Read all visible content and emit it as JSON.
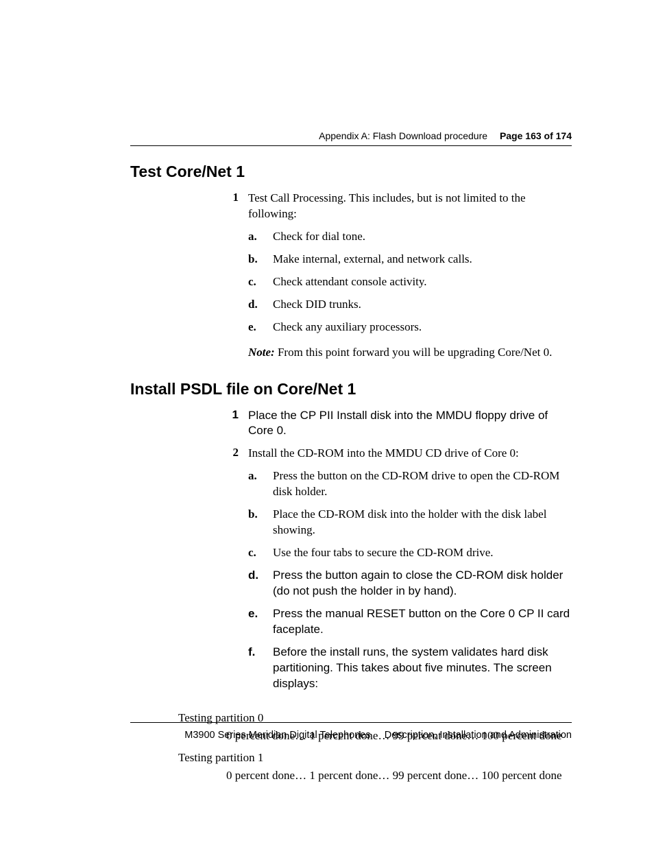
{
  "header": {
    "appendix": "Appendix A: Flash Download procedure",
    "page": "Page 163 of 174"
  },
  "section1": {
    "heading": "Test Core/Net 1",
    "steps": [
      {
        "num": "1",
        "text": "Test Call Processing. This includes, but is not limited to the following:",
        "sub": [
          {
            "m": "a.",
            "t": "Check for dial tone."
          },
          {
            "m": "b.",
            "t": "Make internal, external, and network calls."
          },
          {
            "m": "c.",
            "t": "Check attendant console activity."
          },
          {
            "m": "d.",
            "t": "Check DID trunks."
          },
          {
            "m": "e.",
            "t": "Check any auxiliary processors."
          }
        ],
        "note_label": "Note:",
        "note_text": "From this point forward you will be upgrading Core/Net 0."
      }
    ]
  },
  "section2": {
    "heading": "Install PSDL file on Core/Net 1",
    "steps": [
      {
        "num": "1",
        "text": "Place the CP PII Install disk into the MMDU floppy drive of Core 0."
      },
      {
        "num": "2",
        "text": "Install the CD-ROM into the MMDU CD drive of Core 0:",
        "sub": [
          {
            "m": "a.",
            "t": "Press the button on the CD-ROM drive to open the CD-ROM disk holder."
          },
          {
            "m": "b.",
            "t": "Place the CD-ROM disk into the holder with the disk label showing."
          },
          {
            "m": "c.",
            "t": "Use the four tabs to secure the CD-ROM drive."
          },
          {
            "m": "d.",
            "t": "Press the button again to close the CD-ROM disk holder (do not push the holder in by hand)."
          },
          {
            "m": "e.",
            "t": "Press the manual RESET button on the Core 0 CP II card faceplate."
          },
          {
            "m": "f.",
            "t": "Before the install runs, the system validates hard disk partitioning. This takes about five minutes. The screen displays:"
          }
        ]
      }
    ]
  },
  "testing": {
    "p0": "Testing partition 0",
    "p0_line": "0 percent done… 1 percent done…  99 percent done…  100 percent done",
    "p1": "Testing partition 1",
    "p1_line": "0 percent done… 1 percent done…  99 percent done…  100 percent done"
  },
  "footer": {
    "left": "M3900 Series Meridian Digital Telephones",
    "right": "Description, Installation and Administration"
  }
}
